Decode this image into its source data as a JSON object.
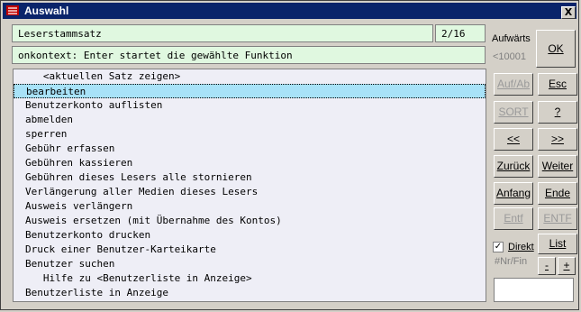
{
  "window": {
    "title": "Auswahl",
    "close_glyph": "X"
  },
  "header": {
    "context_name": "Leserstammsatz",
    "position": "2/16",
    "hint": "onkontext: Enter startet die gewählte Funktion"
  },
  "list": {
    "items": [
      "   <aktuellen Satz zeigen>",
      "bearbeiten",
      "Benutzerkonto auflisten",
      "abmelden",
      "sperren",
      "Gebühr erfassen",
      "Gebühren kassieren",
      "Gebühren dieses Lesers alle stornieren",
      "Verlängerung aller Medien dieses Lesers",
      "Ausweis verlängern",
      "Ausweis ersetzen (mit Übernahme des Kontos)",
      "Benutzerkonto drucken",
      "Druck einer Benutzer-Karteikarte",
      "Benutzer suchen",
      "   Hilfe zu <Benutzerliste in Anzeige>",
      "Benutzerliste in Anzeige"
    ],
    "selected_index": 1
  },
  "side": {
    "aufwaerts_label": "Aufwärts",
    "range_label": "<10001",
    "ok": "OK",
    "auf_ab": "Auf/Ab",
    "esc": "Esc",
    "sort": "SORT",
    "help": "?",
    "prev": "<<",
    "next": ">>",
    "zurueck": "Zurück",
    "weiter": "Weiter",
    "anfang": "Anfang",
    "ende": "Ende",
    "entf": "Entf",
    "entf_caps": "ENTF",
    "direkt": "Direkt",
    "direkt_checked": "✓",
    "nr_fin": "#Nr/Fin",
    "list": "List",
    "minus": "-",
    "plus": "+"
  },
  "colors": {
    "titlebar": "#0a246a",
    "field_bg": "#e0f8e0",
    "list_bg": "#eeeef6",
    "selection": "#a8e2f8",
    "window_bg": "#d4d0c8"
  }
}
